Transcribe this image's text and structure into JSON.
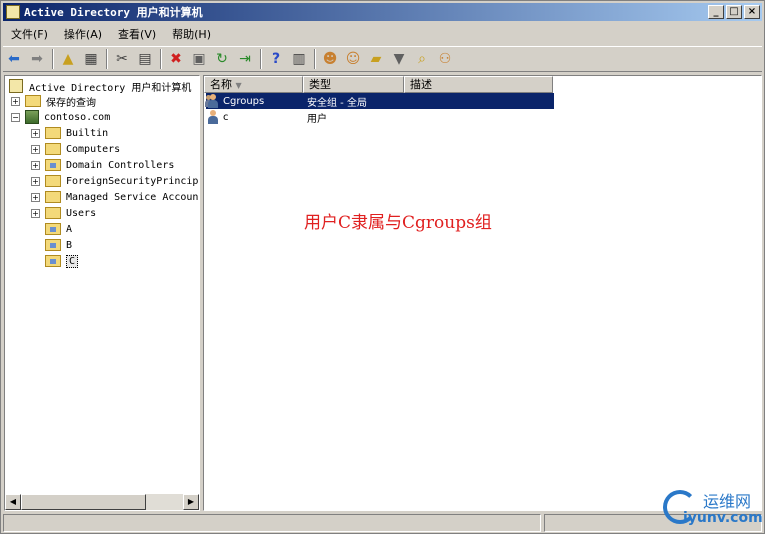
{
  "window": {
    "title": "Active Directory 用户和计算机",
    "controls": {
      "minimize": "_",
      "maximize": "□",
      "close": "×"
    }
  },
  "menubar": {
    "items": [
      "文件(F)",
      "操作(A)",
      "查看(V)",
      "帮助(H)"
    ]
  },
  "toolbar": {
    "icons": [
      "back-icon",
      "forward-icon",
      "up-folder-icon",
      "show-hide-tree-icon",
      "cut-icon",
      "copy-icon",
      "delete-icon",
      "properties-icon",
      "refresh-icon",
      "export-list-icon",
      "help-icon",
      "show-console-tree-icon",
      "create-user-icon",
      "create-group-icon",
      "create-ou-icon",
      "filter-icon",
      "find-icon",
      "add-to-group-icon"
    ]
  },
  "tree": {
    "root": "Active Directory 用户和计算机",
    "saved_queries": "保存的查询",
    "domain": "contoso.com",
    "containers": [
      "Builtin",
      "Computers",
      "Domain Controllers",
      "ForeignSecurityPrincipals",
      "Managed Service Accounts",
      "Users"
    ],
    "ous": [
      "A",
      "B",
      "C"
    ],
    "selected": "C"
  },
  "list": {
    "columns": [
      "名称",
      "类型",
      "描述"
    ],
    "rows": [
      {
        "name": "Cgroups",
        "type": "安全组 - 全局",
        "description": "",
        "icon": "group-icon"
      },
      {
        "name": "c",
        "type": "用户",
        "description": "",
        "icon": "user-icon"
      }
    ]
  },
  "annotation": "用户C隶属与Cgroups组",
  "watermark": {
    "cn": "运维网",
    "en": "iyunv.com"
  },
  "colors": {
    "title_bar": "#0a246a",
    "selection": "#0a246a",
    "annotation": "#e02020"
  }
}
